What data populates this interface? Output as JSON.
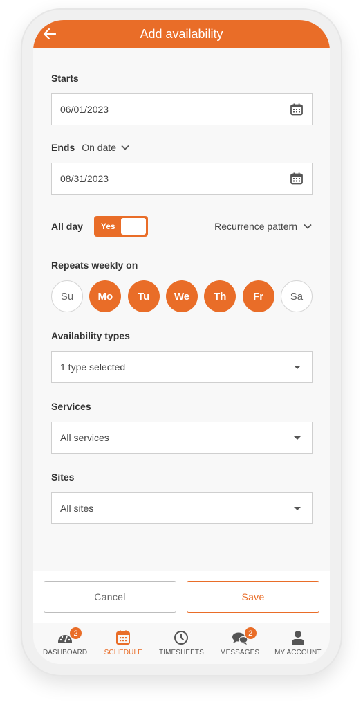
{
  "header": {
    "title": "Add availability",
    "back_icon": "arrow-left-icon"
  },
  "starts": {
    "label": "Starts",
    "value": "06/01/2023",
    "icon": "calendar-icon"
  },
  "ends": {
    "label": "Ends",
    "mode": "On date",
    "value": "08/31/2023",
    "icon": "calendar-icon"
  },
  "all_day": {
    "label": "All day",
    "toggle_label": "Yes",
    "on": true
  },
  "recurrence": {
    "label": "Recurrence pattern"
  },
  "repeats": {
    "label": "Repeats weekly on",
    "days": [
      {
        "label": "Su",
        "selected": false
      },
      {
        "label": "Mo",
        "selected": true
      },
      {
        "label": "Tu",
        "selected": true
      },
      {
        "label": "We",
        "selected": true
      },
      {
        "label": "Th",
        "selected": true
      },
      {
        "label": "Fr",
        "selected": true
      },
      {
        "label": "Sa",
        "selected": false
      }
    ]
  },
  "availability_types": {
    "label": "Availability types",
    "value": "1 type selected"
  },
  "services": {
    "label": "Services",
    "value": "All services"
  },
  "sites": {
    "label": "Sites",
    "value": "All sites"
  },
  "actions": {
    "cancel": "Cancel",
    "save": "Save"
  },
  "tabs": [
    {
      "label": "DASHBOARD",
      "icon": "dashboard-gauge-icon",
      "badge": "2",
      "active": false
    },
    {
      "label": "SCHEDULE",
      "icon": "calendar-icon",
      "active": true
    },
    {
      "label": "TIMESHEETS",
      "icon": "clock-icon",
      "active": false
    },
    {
      "label": "MESSAGES",
      "icon": "chat-bubbles-icon",
      "badge": "2",
      "active": false
    },
    {
      "label": "MY ACCOUNT",
      "icon": "person-icon",
      "active": false
    }
  ],
  "colors": {
    "accent": "#e96d28",
    "background": "#f8f8f8",
    "border": "#cfcfcf"
  }
}
